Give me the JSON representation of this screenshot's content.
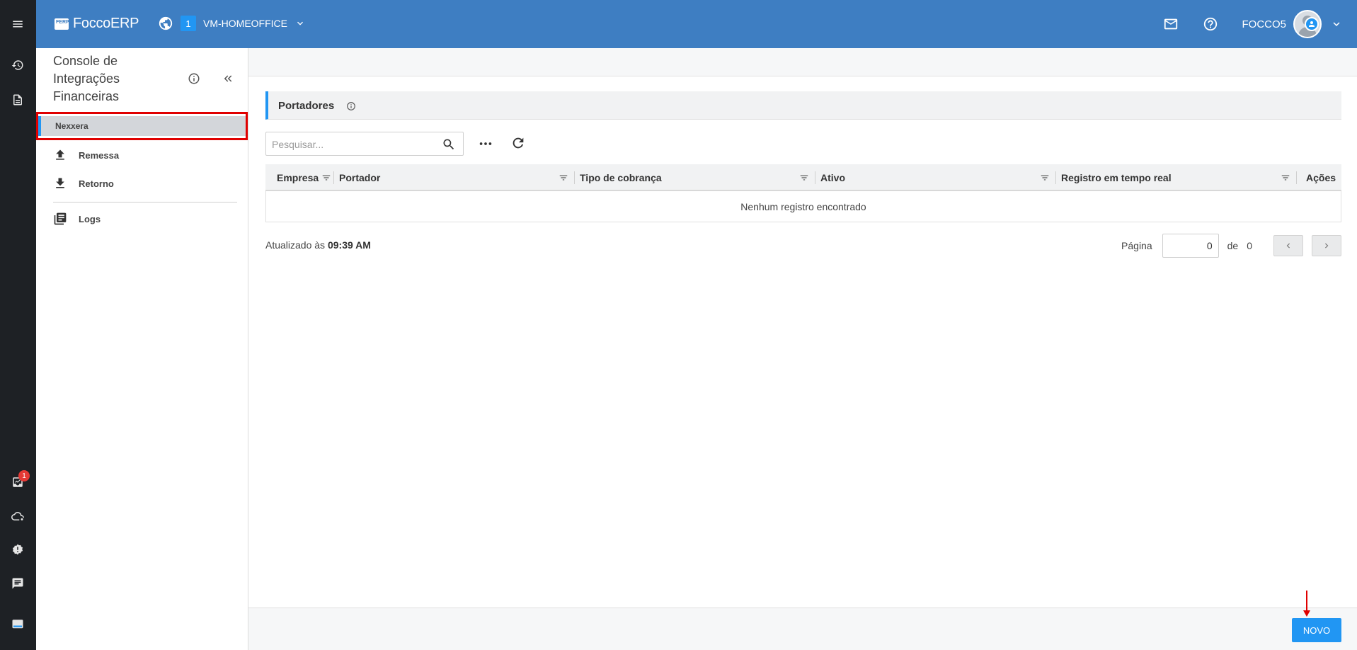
{
  "header": {
    "logo_badge": "FERP",
    "logo_text": "FoccoERP",
    "env_number": "1",
    "env_name": "VM-HOMEOFFICE",
    "user_name": "FOCCO5"
  },
  "rail": {
    "notification_count": "1",
    "brand_badge": "FERP"
  },
  "sidebar": {
    "title": "Console de Integrações Financeiras",
    "selected_item": "Nexxera",
    "items": [
      {
        "label": "Remessa",
        "icon": "upload-icon"
      },
      {
        "label": "Retorno",
        "icon": "download-icon"
      },
      {
        "label": "Logs",
        "icon": "logs-icon"
      }
    ]
  },
  "main": {
    "panel_title": "Portadores",
    "search_placeholder": "Pesquisar...",
    "columns": [
      "Empresa",
      "Portador",
      "Tipo de cobrança",
      "Ativo",
      "Registro em tempo real",
      "Ações"
    ],
    "empty_message": "Nenhum registro encontrado",
    "updated_prefix": "Atualizado às",
    "updated_time": "09:39 AM",
    "pager": {
      "page_label": "Página",
      "page_value": "0",
      "of_label": "de",
      "total": "0"
    },
    "new_button": "NOVO"
  },
  "colors": {
    "header": "#3e7ec2",
    "accent": "#2196f3",
    "rail": "#1e2125",
    "highlight": "#e00000"
  }
}
